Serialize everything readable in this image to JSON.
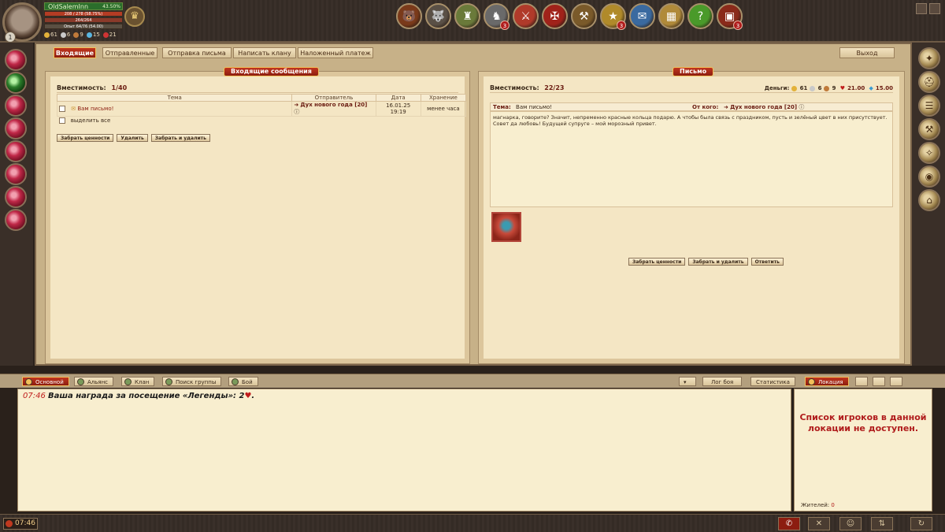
{
  "player": {
    "name": "OldSalemInn",
    "level": "1",
    "name_pct": "43.50%",
    "hp": "208 / 278 (58.75%)",
    "mp": "264/264",
    "xp": "Опыт 64/76 (54.00)",
    "currency": {
      "gold": "61",
      "silver": "6",
      "copper": "9",
      "gems": "15",
      "hearts": "21"
    }
  },
  "top_icons": [
    {
      "name": "bear-icon",
      "badge": ""
    },
    {
      "name": "wolf-icon",
      "badge": ""
    },
    {
      "name": "castle-icon",
      "badge": ""
    },
    {
      "name": "knight-icon",
      "badge": "3"
    },
    {
      "name": "arena-icon",
      "badge": ""
    },
    {
      "name": "clan-icon",
      "badge": ""
    },
    {
      "name": "craft-icon",
      "badge": ""
    },
    {
      "name": "quest-icon",
      "badge": "3"
    },
    {
      "name": "map-icon",
      "badge": ""
    },
    {
      "name": "treasury-icon",
      "badge": ""
    },
    {
      "name": "help-icon",
      "badge": ""
    },
    {
      "name": "chest-icon",
      "badge": "3"
    }
  ],
  "tabs": {
    "inbox": "Входящие",
    "sent": "Отправленные",
    "send": "Отправка письма",
    "write_clan": "Написать клану",
    "cod": "Наложенный платеж",
    "exit": "Выход"
  },
  "inbox": {
    "title": "Входящие сообщения",
    "capacity_label": "Вместимость:",
    "capacity_value": "1/40",
    "columns": [
      "Тема",
      "Отправитель",
      "Дата",
      "Хранение"
    ],
    "rows": [
      {
        "subject": "Вам письмо!",
        "sender": "Дух нового года [20]",
        "date": "16.01.25 19:19",
        "storage": "менее часа"
      }
    ],
    "select_all": "выделить все",
    "buttons": {
      "take": "Забрать ценности",
      "delete": "Удалить",
      "take_delete": "Забрать и удалить"
    }
  },
  "letter": {
    "title": "Письмо",
    "capacity_label": "Вместимость:",
    "capacity_value": "22/23",
    "money_label": "Деньги:",
    "money": {
      "gold": "61",
      "silver": "6",
      "copper": "9",
      "hearts": "21.00",
      "gems": "15.00"
    },
    "subject_label": "Тема:",
    "subject": "Вам письмо!",
    "from_label": "От кого:",
    "from": "Дух нового года [20]",
    "body": "магнарка, говорите? Значит, непременно красные кольца подарю. А чтобы была связь с праздником, пусть и зелёный цвет в них присутствует. Совет да любовь! Будущей супруге – мой морозный привет.",
    "buttons": {
      "take": "Забрать ценности",
      "take_delete": "Забрать и удалить",
      "reply": "Ответить"
    }
  },
  "chat": {
    "tabs": [
      "Основной",
      "Альянс",
      "Клан",
      "Поиск группы",
      "Бой"
    ],
    "right_tabs": [
      "Лог боя",
      "Статистика"
    ],
    "location_tab": "Локация",
    "message_time": "07:46",
    "message_text": "Ваша награда за посещение «Легенды»: 2",
    "players_message": "Список игроков в данной локации не доступен.",
    "residents_label": "Жителей:",
    "residents_value": "0"
  },
  "clock": "07:46",
  "colors": {
    "accent_red": "#8c1d10",
    "parchment": "#f4e6c4",
    "frame": "#c7b188"
  }
}
